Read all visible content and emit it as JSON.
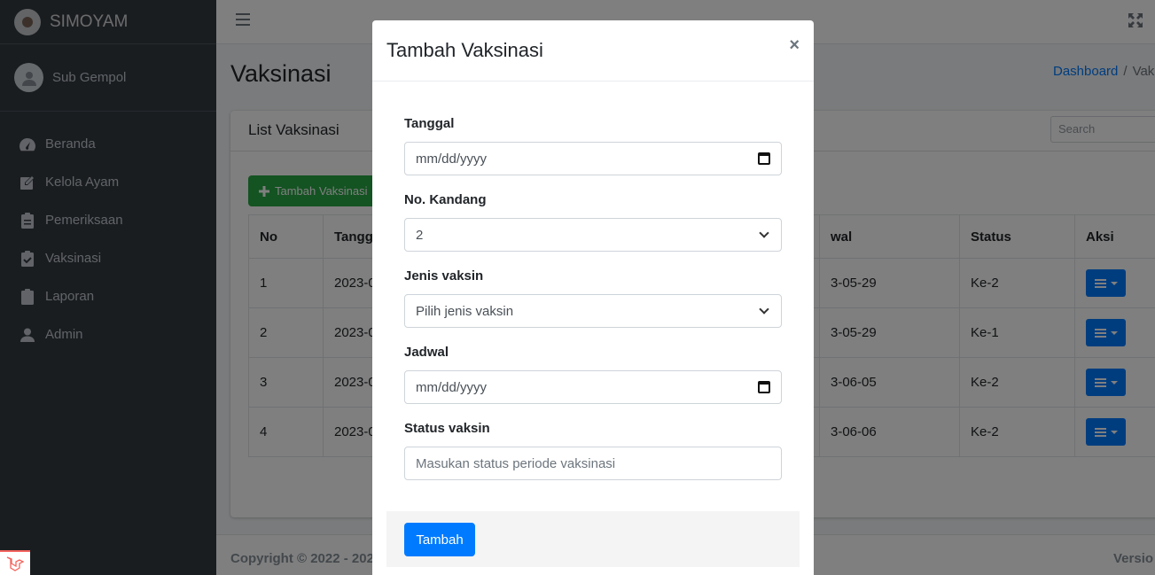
{
  "app": {
    "brand": "SIMOYAM",
    "user": "Sub Gempol"
  },
  "sidebar": {
    "items": [
      {
        "label": "Beranda",
        "icon": "tachometer-icon"
      },
      {
        "label": "Kelola Ayam",
        "icon": "edit-icon"
      },
      {
        "label": "Pemeriksaan",
        "icon": "clipboard-icon"
      },
      {
        "label": "Vaksinasi",
        "icon": "clipboard-check-icon"
      },
      {
        "label": "Laporan",
        "icon": "clipboard-icon"
      },
      {
        "label": "Admin",
        "icon": "user-icon"
      }
    ]
  },
  "page": {
    "title": "Vaksinasi",
    "breadcrumb": {
      "home": "Dashboard",
      "sep": "/",
      "current": "Vak"
    }
  },
  "card": {
    "header": "List Vaksinasi",
    "add_button": "Tambah Vaksinasi",
    "search_placeholder": "Search"
  },
  "table": {
    "headers": {
      "no": "No",
      "tanggal": "Tangg",
      "jadwal": "wal",
      "status": "Status",
      "aksi": "Aksi"
    },
    "rows": [
      {
        "no": "1",
        "tanggal": "2023-0",
        "jadwal": "3-05-29",
        "status": "Ke-2"
      },
      {
        "no": "2",
        "tanggal": "2023-0",
        "jadwal": "3-05-29",
        "status": "Ke-1"
      },
      {
        "no": "3",
        "tanggal": "2023-0",
        "jadwal": "3-06-05",
        "status": "Ke-2"
      },
      {
        "no": "4",
        "tanggal": "2023-0",
        "jadwal": "3-06-06",
        "status": "Ke-2"
      }
    ]
  },
  "footer": {
    "copyright": "Copyright © 2022 - 202",
    "version": "Versio"
  },
  "modal": {
    "title": "Tambah Vaksinasi",
    "close": "×",
    "fields": {
      "tanggal_label": "Tanggal",
      "tanggal_value": "mm/dd/yyyy",
      "kandang_label": "No. Kandang",
      "kandang_value": "2",
      "vaksin_label": "Jenis vaksin",
      "vaksin_value": "Pilih jenis vaksin",
      "jadwal_label": "Jadwal",
      "jadwal_value": "mm/dd/yyyy",
      "status_label": "Status vaksin",
      "status_placeholder": "Masukan status periode vaksinasi"
    },
    "submit": "Tambah"
  },
  "colors": {
    "primary": "#007bff",
    "success": "#28a745",
    "sidebar": "#343a40"
  }
}
